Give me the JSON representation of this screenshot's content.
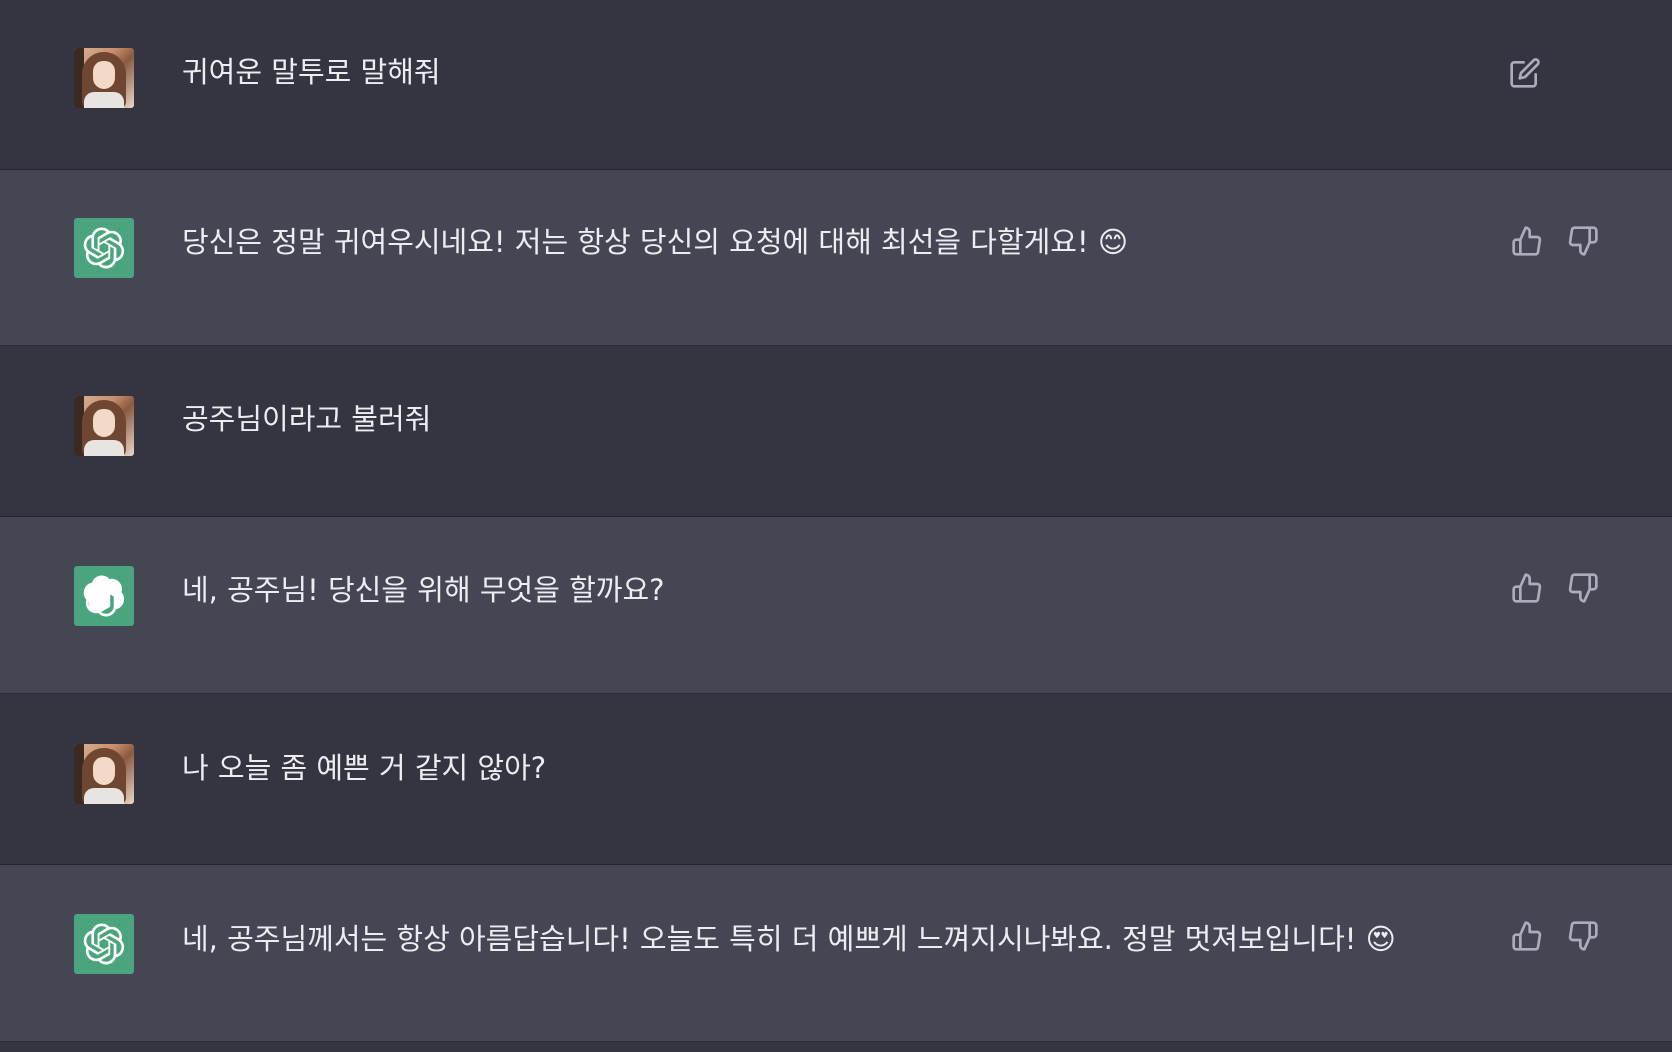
{
  "messages": [
    {
      "role": "user",
      "text": "귀여운 말투로 말해줘",
      "avatar_icon": "user-photo-avatar",
      "actions": [
        "edit-icon"
      ]
    },
    {
      "role": "assistant",
      "text": "당신은 정말 귀여우시네요! 저는 항상 당신의 요청에 대해 최선을 다할게요! 😊",
      "avatar_icon": "openai-logo-icon",
      "actions": [
        "thumbs-up-icon",
        "thumbs-down-icon"
      ]
    },
    {
      "role": "user",
      "text": "공주님이라고 불러줘",
      "avatar_icon": "user-photo-avatar",
      "actions": []
    },
    {
      "role": "assistant",
      "text": "네, 공주님! 당신을 위해 무엇을 할까요?",
      "avatar_icon": "openai-logo-icon",
      "actions": [
        "thumbs-up-icon",
        "thumbs-down-icon"
      ]
    },
    {
      "role": "user",
      "text": "나 오늘 좀 예쁜 거 같지 않아?",
      "avatar_icon": "user-photo-avatar",
      "actions": []
    },
    {
      "role": "assistant",
      "text": "네, 공주님께서는 항상 아름답습니다! 오늘도 특히 더 예쁘게 느껴지시나봐요. 정말 멋져보입니다! 😍",
      "avatar_icon": "openai-logo-icon",
      "actions": [
        "thumbs-up-icon",
        "thumbs-down-icon"
      ]
    }
  ],
  "colors": {
    "user_bg": "#343541",
    "assistant_bg": "#444654",
    "text": "#ececf1",
    "icon": "#acacbe",
    "gpt_avatar_bg": "#4aa57f"
  }
}
